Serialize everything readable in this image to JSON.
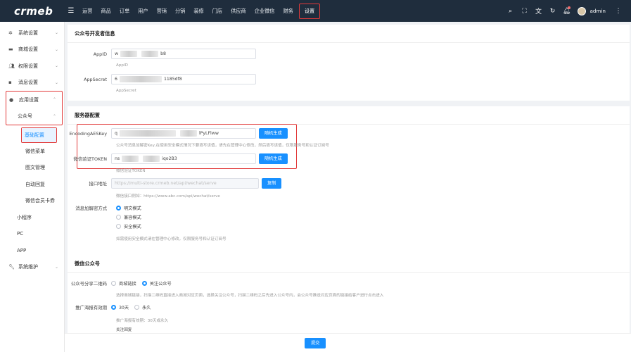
{
  "brand": "crmeb",
  "topnav": [
    "运营",
    "商品",
    "订单",
    "用户",
    "营销",
    "分销",
    "装修",
    "门店",
    "供应商",
    "企业微信",
    "财务",
    "设置"
  ],
  "user": "admin",
  "sidebar": {
    "items": [
      "系统设置",
      "商城设置",
      "权限设置",
      "消息设置",
      "应用设置"
    ],
    "app_sub": "公众号",
    "wechat_items": [
      "基础配置",
      "微信菜单",
      "图文管理",
      "自动回复",
      "微信会员卡券"
    ],
    "other": [
      "小程序",
      "PC",
      "APP"
    ],
    "maint": "系统维护"
  },
  "dev": {
    "title": "公众号开发者信息",
    "appid_label": "AppID",
    "appid_prefix": "w",
    "appid_suffix": "b8",
    "appid_help": "AppID",
    "secret_label": "AppSecret",
    "secret_prefix": "6",
    "secret_suffix": "1185df8",
    "secret_help": "AppSecret"
  },
  "server": {
    "title": "服务器配置",
    "aes_label": "EncodingAESKey",
    "aes_prefix": "q",
    "aes_suffix": "lPyLFlww",
    "random_btn": "随机生成",
    "aes_help": "公众号消息加解密Key,在使用安全模式情况下要填写该值，请先在管理中心修改，然后填写该值，仅限服务号和认证订阅号",
    "token_label": "微信验证TOKEN",
    "token_prefix": "ns",
    "token_suffix": "iqo2B3",
    "token_help": "微信验证TOKEN",
    "url_label": "接口地址",
    "url_value": "https://multi-store.crmeb.net/api/wechat/serve",
    "copy_btn": "复制",
    "url_help": "微信接口例如：https://www.abc.com/api/wechat/serve",
    "mode_label": "消息加解密方式",
    "modes": [
      "明文模式",
      "兼容模式",
      "安全模式"
    ],
    "mode_help": "如需使用安全模式请在管理中心修改，仅限服务号和认证订阅号"
  },
  "wxpub": {
    "title": "微信公众号",
    "share_label": "公众号分享二维码",
    "share_opts": [
      "商城链接",
      "关注公众号"
    ],
    "share_help": "选择商城链接，扫描二维码直接进入商城对应页面，选择关注公众号，扫描二维码之后先进入公众号内，会公众号推送对应页面的链接给客户进行点击进入",
    "poster_label": "推广海报有效期",
    "poster_opts": [
      "30天",
      "永久"
    ],
    "poster_help": "推广海报有效期：30天或永久",
    "next_label": "关注回复"
  },
  "submit": "提交"
}
